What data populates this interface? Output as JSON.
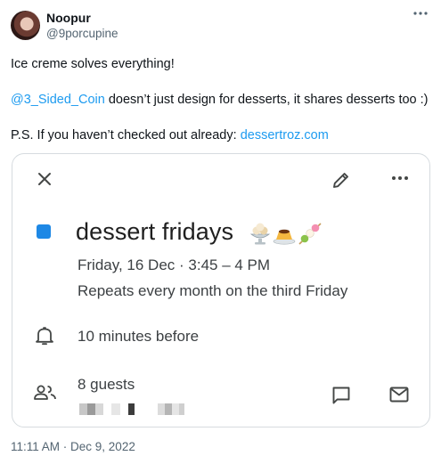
{
  "author": {
    "name": "Noopur",
    "handle": "@9porcupine"
  },
  "tweet": {
    "line1": "Ice creme solves everything!",
    "mention": "@3_Sided_Coin",
    "line2_rest": " doesn’t just design for desserts, it shares desserts too :)",
    "line3_prefix": "P.S. If you haven’t checked out already: ",
    "link": "dessertroz.com"
  },
  "event_card": {
    "title": "dessert fridays",
    "emojis": [
      "ice-cream-sundae",
      "custard-flan",
      "dango"
    ],
    "date_time": "Friday, 16 Dec · 3:45 – 4 PM",
    "recurrence": "Repeats every month on the third Friday",
    "reminder": "10 minutes before",
    "guests": "8 guests",
    "accent_color": "#1e88e5"
  },
  "icons": [
    "more-icon",
    "close-icon",
    "edit-icon",
    "kebab-icon",
    "bell-icon",
    "guests-icon",
    "chat-icon",
    "mail-icon"
  ],
  "timestamp": "11:11 AM · Dec 9, 2022",
  "colors": {
    "link": "#1d9bf0",
    "text": "#0f1419",
    "muted": "#536471",
    "card_border": "#d6dbdf"
  }
}
